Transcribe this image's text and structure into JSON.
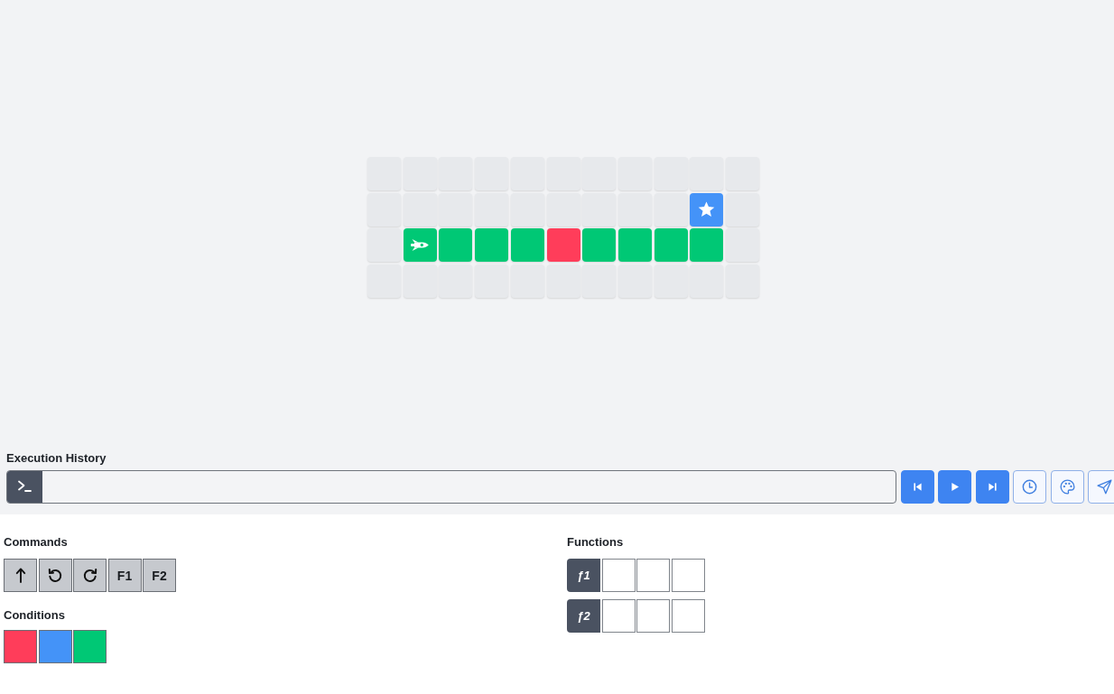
{
  "board": {
    "rows": [
      [
        {
          "kind": "empty"
        },
        {
          "kind": "empty"
        },
        {
          "kind": "empty"
        },
        {
          "kind": "empty"
        },
        {
          "kind": "empty"
        },
        {
          "kind": "empty"
        },
        {
          "kind": "empty"
        },
        {
          "kind": "empty"
        },
        {
          "kind": "empty"
        },
        {
          "kind": "empty"
        },
        {
          "kind": "empty"
        }
      ],
      [
        {
          "kind": "empty"
        },
        {
          "kind": "empty"
        },
        {
          "kind": "empty"
        },
        {
          "kind": "empty"
        },
        {
          "kind": "empty"
        },
        {
          "kind": "empty"
        },
        {
          "kind": "empty"
        },
        {
          "kind": "empty"
        },
        {
          "kind": "empty"
        },
        {
          "kind": "goal",
          "color": "#4493f8"
        },
        {
          "kind": "empty"
        }
      ],
      [
        {
          "kind": "empty"
        },
        {
          "kind": "start",
          "color": "#00c875"
        },
        {
          "kind": "floor",
          "color": "#00c875"
        },
        {
          "kind": "floor",
          "color": "#00c875"
        },
        {
          "kind": "floor",
          "color": "#00c875"
        },
        {
          "kind": "floor",
          "color": "#ff3d5a"
        },
        {
          "kind": "floor",
          "color": "#00c875"
        },
        {
          "kind": "floor",
          "color": "#00c875"
        },
        {
          "kind": "floor",
          "color": "#00c875"
        },
        {
          "kind": "floor",
          "color": "#00c875"
        },
        {
          "kind": "empty"
        }
      ],
      [
        {
          "kind": "empty"
        },
        {
          "kind": "empty"
        },
        {
          "kind": "empty"
        },
        {
          "kind": "empty"
        },
        {
          "kind": "empty"
        },
        {
          "kind": "empty"
        },
        {
          "kind": "empty"
        },
        {
          "kind": "empty"
        },
        {
          "kind": "empty"
        },
        {
          "kind": "empty"
        },
        {
          "kind": "empty"
        }
      ]
    ]
  },
  "execution_history": {
    "label": "Execution History",
    "controls": [
      {
        "kind": "step-back",
        "filled": true
      },
      {
        "kind": "play",
        "filled": true
      },
      {
        "kind": "step-forward",
        "filled": true
      },
      {
        "kind": "history",
        "filled": false
      },
      {
        "kind": "palette",
        "filled": false
      },
      {
        "kind": "send",
        "filled": false
      }
    ]
  },
  "commands": {
    "label": "Commands",
    "items": [
      {
        "kind": "forward"
      },
      {
        "kind": "turn-left"
      },
      {
        "kind": "turn-right"
      },
      {
        "kind": "call",
        "label": "F1"
      },
      {
        "kind": "call",
        "label": "F2"
      }
    ]
  },
  "conditions": {
    "label": "Conditions",
    "items": [
      {
        "color": "#ff3d5a"
      },
      {
        "color": "#4493f8"
      },
      {
        "color": "#00c875"
      }
    ]
  },
  "functions": {
    "label": "Functions",
    "items": [
      {
        "label": "ƒ1",
        "slots": [
          {
            "kind": "empty"
          },
          {
            "kind": "empty"
          },
          {
            "kind": "empty"
          }
        ]
      },
      {
        "label": "ƒ2",
        "slots": [
          {
            "kind": "empty"
          },
          {
            "kind": "empty"
          },
          {
            "kind": "empty"
          }
        ]
      }
    ]
  }
}
